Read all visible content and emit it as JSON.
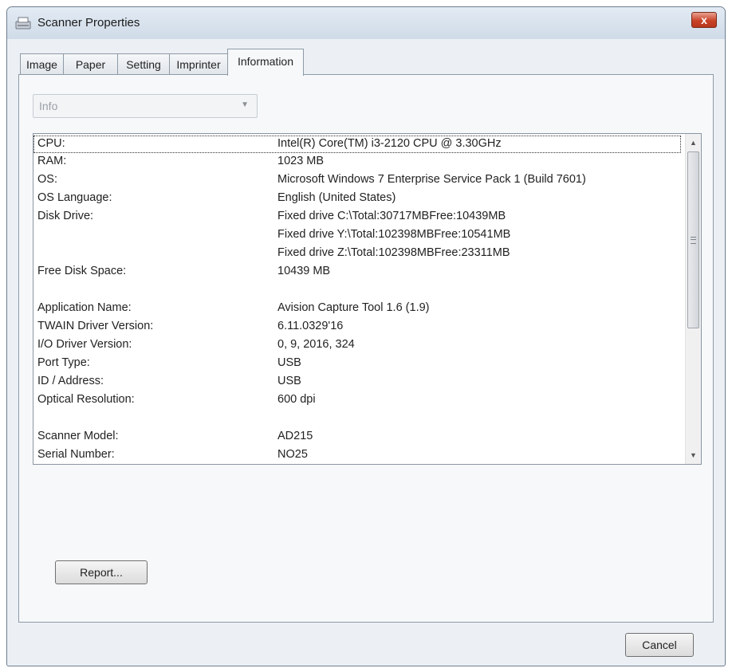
{
  "window": {
    "title": "Scanner Properties",
    "close_label": "x"
  },
  "tabs": [
    {
      "label": "Image",
      "active": false
    },
    {
      "label": "Paper",
      "active": false
    },
    {
      "label": "Setting",
      "active": false
    },
    {
      "label": "Imprinter",
      "active": false
    },
    {
      "label": "Information",
      "active": true
    }
  ],
  "info_select": {
    "selected": "Info"
  },
  "info_rows": [
    {
      "label": "CPU:",
      "value": "Intel(R) Core(TM) i3-2120 CPU @ 3.30GHz"
    },
    {
      "label": "RAM:",
      "value": "1023 MB"
    },
    {
      "label": "OS:",
      "value": "Microsoft Windows 7 Enterprise Service Pack 1 (Build 7601)"
    },
    {
      "label": "OS Language:",
      "value": "English (United States)"
    },
    {
      "label": "Disk Drive:",
      "value": "Fixed drive C:\\Total:30717MBFree:10439MB"
    },
    {
      "label": "",
      "value": "Fixed drive Y:\\Total:102398MBFree:10541MB"
    },
    {
      "label": "",
      "value": "Fixed drive Z:\\Total:102398MBFree:23311MB"
    },
    {
      "label": "Free Disk Space:",
      "value": "10439 MB"
    },
    {
      "label": "Application Name:",
      "value": "Avision Capture Tool 1.6 (1.9)"
    },
    {
      "label": "TWAIN Driver Version:",
      "value": "6.11.0329'16"
    },
    {
      "label": "I/O Driver Version:",
      "value": "0, 9, 2016, 324"
    },
    {
      "label": "Port Type:",
      "value": "USB"
    },
    {
      "label": "ID / Address:",
      "value": "USB"
    },
    {
      "label": "Optical Resolution:",
      "value": "600 dpi"
    },
    {
      "label": "Scanner Model:",
      "value": "AD215"
    },
    {
      "label": "Serial Number:",
      "value": "NO25"
    }
  ],
  "buttons": {
    "report_label": "Report...",
    "cancel_label": "Cancel"
  },
  "colors": {
    "close_button": "#c84328",
    "window_bg": "#ecf0f5"
  }
}
